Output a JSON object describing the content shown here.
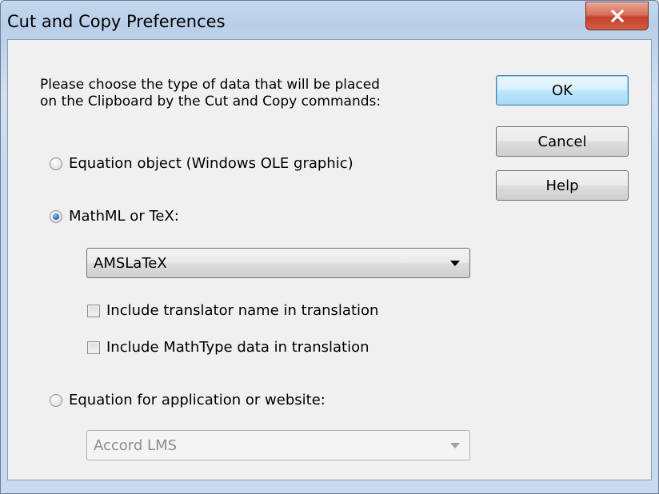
{
  "window": {
    "title": "Cut and Copy Preferences"
  },
  "prompt": {
    "line1": "Please choose the type of data that will be placed",
    "line2": "on the Clipboard by the Cut and Copy commands:"
  },
  "buttons": {
    "ok": "OK",
    "cancel": "Cancel",
    "help": "Help"
  },
  "options": {
    "equation_object": {
      "label": "Equation object (Windows OLE graphic)",
      "checked": false
    },
    "mathml_tex": {
      "label": "MathML or TeX:",
      "checked": true
    },
    "mathml_select": {
      "value": "AMSLaTeX"
    },
    "include_translator": {
      "label": "Include translator name in translation",
      "checked": false
    },
    "include_mathtype": {
      "label": "Include MathType data in translation",
      "checked": false
    },
    "equation_app": {
      "label": "Equation for application or website:",
      "checked": false
    },
    "app_select": {
      "value": "Accord LMS",
      "disabled": true
    }
  },
  "icons": {
    "close": "close-icon",
    "dropdown": "chevron-down-icon"
  }
}
